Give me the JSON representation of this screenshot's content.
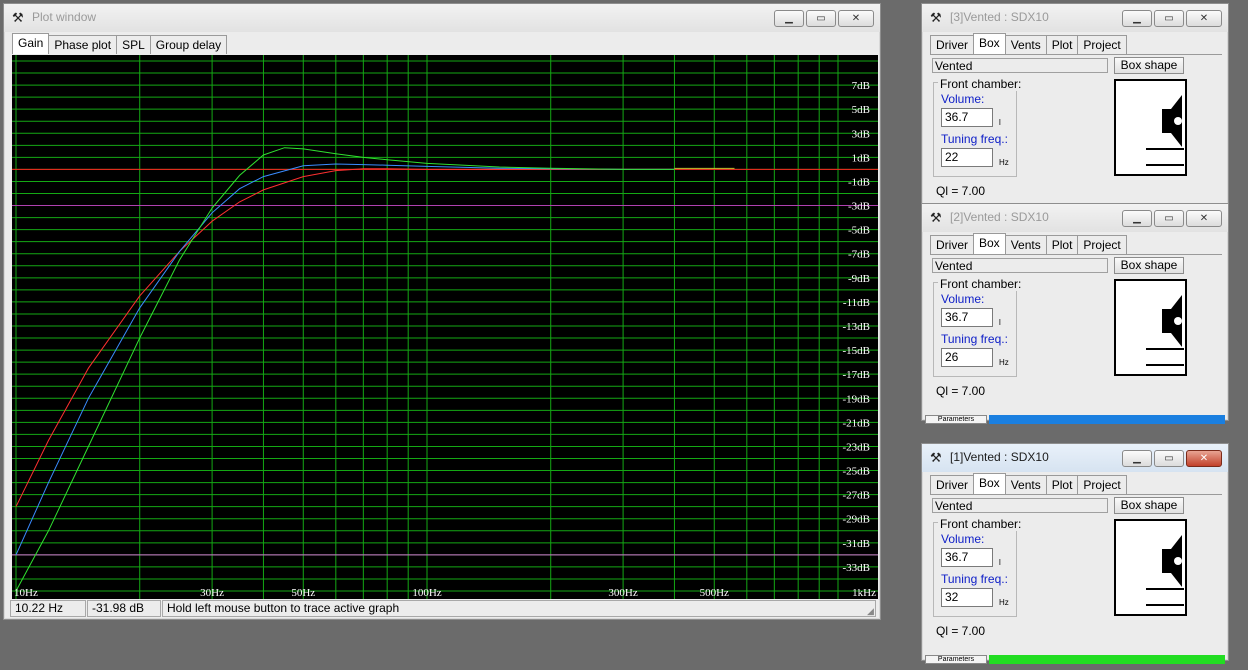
{
  "plot_window": {
    "title": "Plot window",
    "tabs": [
      "Gain",
      "Phase plot",
      "SPL",
      "Group delay"
    ],
    "selected_tab": "Gain",
    "status": {
      "freq": "10.22 Hz",
      "level": "-31.98 dB",
      "hint": "Hold left mouse button to trace active graph"
    }
  },
  "chart_data": {
    "type": "line",
    "title": "",
    "xlabel": "",
    "ylabel": "",
    "x_scale": "log",
    "xlim": [
      10,
      1000
    ],
    "ylim": [
      -35,
      9
    ],
    "x_tick_labels": [
      {
        "x": 10,
        "label": "10Hz"
      },
      {
        "x": 30,
        "label": "30Hz"
      },
      {
        "x": 50,
        "label": "50Hz"
      },
      {
        "x": 100,
        "label": "100Hz"
      },
      {
        "x": 300,
        "label": "300Hz"
      },
      {
        "x": 500,
        "label": "500Hz"
      },
      {
        "x": 1000,
        "label": "1kHz"
      }
    ],
    "y_tick_labels": [
      "7dB",
      "5dB",
      "3dB",
      "1dB",
      "-1dB",
      "-3dB",
      "-5dB",
      "-7dB",
      "-9dB",
      "-11dB",
      "-13dB",
      "-15dB",
      "-17dB",
      "-19dB",
      "-21dB",
      "-23dB",
      "-25dB",
      "-27dB",
      "-29dB",
      "-31dB",
      "-33dB"
    ],
    "y_tick_values": [
      7,
      5,
      3,
      1,
      -1,
      -3,
      -5,
      -7,
      -9,
      -11,
      -13,
      -15,
      -17,
      -19,
      -21,
      -23,
      -25,
      -27,
      -29,
      -31,
      -33
    ],
    "grid": true,
    "reference_lines": [
      {
        "y": 0,
        "color": "#ff2020"
      },
      {
        "y": -3,
        "color": "#b040b0"
      },
      {
        "y": -32,
        "color": "#d070d0"
      }
    ],
    "series": [
      {
        "color": "#ff3030",
        "x": [
          10,
          12,
          15,
          20,
          25,
          30,
          35,
          40,
          50,
          60,
          70,
          80,
          100,
          150,
          200,
          300,
          400
        ],
        "y": [
          -28,
          -22.5,
          -16.5,
          -10.5,
          -6.8,
          -4.3,
          -2.7,
          -1.7,
          -0.6,
          -0.1,
          0.05,
          0.05,
          0.0,
          0.0,
          0.0,
          0.0,
          0.0
        ]
      },
      {
        "color": "#3a8cff",
        "x": [
          10,
          12,
          15,
          20,
          25,
          30,
          35,
          40,
          50,
          60,
          70,
          80,
          100,
          150,
          200,
          300,
          400
        ],
        "y": [
          -32,
          -26,
          -19,
          -11.5,
          -6.8,
          -3.6,
          -1.6,
          -0.6,
          0.3,
          0.45,
          0.4,
          0.35,
          0.25,
          0.1,
          0.05,
          0.0,
          0.0
        ]
      },
      {
        "color": "#30e030",
        "x": [
          10,
          12,
          15,
          20,
          25,
          30,
          35,
          40,
          45,
          50,
          60,
          70,
          80,
          100,
          150,
          200,
          300,
          400
        ],
        "y": [
          -35,
          -30,
          -23,
          -14,
          -7.5,
          -3.2,
          -0.5,
          1.2,
          1.8,
          1.7,
          1.3,
          1.0,
          0.8,
          0.5,
          0.2,
          0.1,
          0.0,
          0.0
        ]
      }
    ]
  },
  "box_windows": [
    {
      "title": "[3]Vented : SDX10",
      "state": "inactive",
      "tabs": [
        "Driver",
        "Box",
        "Vents",
        "Plot",
        "Project"
      ],
      "selected_tab": "Box",
      "box_type": "Vented",
      "box_shape_label": "Box shape",
      "group_label": "Front chamber:",
      "volume_label": "Volume:",
      "volume": "36.7",
      "volume_unit": "l",
      "tuning_label": "Tuning freq.:",
      "tuning": "22",
      "tuning_unit": "Hz",
      "ql": "Ql = 7.00",
      "progress_label": "",
      "progress_color": "",
      "progress_fraction": 0
    },
    {
      "title": "[2]Vented : SDX10",
      "state": "inactive",
      "tabs": [
        "Driver",
        "Box",
        "Vents",
        "Plot",
        "Project"
      ],
      "selected_tab": "Box",
      "box_type": "Vented",
      "box_shape_label": "Box shape",
      "group_label": "Front chamber:",
      "volume_label": "Volume:",
      "volume": "36.7",
      "volume_unit": "l",
      "tuning_label": "Tuning freq.:",
      "tuning": "26",
      "tuning_unit": "Hz",
      "ql": "Ql = 7.00",
      "progress_label": "Parameters",
      "progress_color": "#1a7fe0",
      "progress_fraction": 1
    },
    {
      "title": "[1]Vented : SDX10",
      "state": "active",
      "tabs": [
        "Driver",
        "Box",
        "Vents",
        "Plot",
        "Project"
      ],
      "selected_tab": "Box",
      "box_type": "Vented",
      "box_shape_label": "Box shape",
      "group_label": "Front chamber:",
      "volume_label": "Volume:",
      "volume": "36.7",
      "volume_unit": "l",
      "tuning_label": "Tuning freq.:",
      "tuning": "32",
      "tuning_unit": "Hz",
      "ql": "Ql = 7.00",
      "progress_label": "Parameters",
      "progress_color": "#22dd22",
      "progress_fraction": 1
    }
  ],
  "icons": {
    "window_icon": "wrench-icon",
    "minimize": "minimize-icon",
    "maximize": "maximize-icon",
    "close": "close-icon"
  }
}
